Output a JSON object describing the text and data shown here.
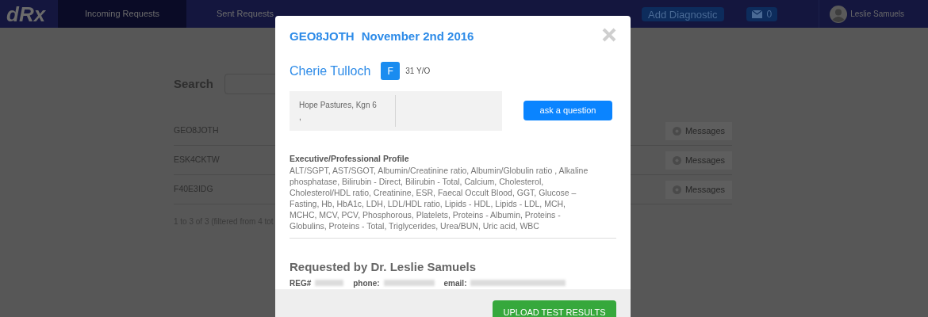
{
  "nav": {
    "logo": "dRx",
    "tabs": [
      {
        "label": "Incoming Requests",
        "selected": true
      },
      {
        "label": "Sent Requests",
        "selected": false
      }
    ],
    "add_button": "Add Diagnostic",
    "messages_count": "0",
    "user": "Leslie Samuels"
  },
  "page": {
    "search_label": "Search",
    "rows": [
      {
        "code": "GEO8JOTH",
        "button": "Messages"
      },
      {
        "code": "ESK4CKTW",
        "button": "Messages"
      },
      {
        "code": "F40E3IDG",
        "button": "Messages"
      }
    ],
    "footer": "1 to 3 of 3 (filtered from 4 tot"
  },
  "modal": {
    "code": "GEO8JOTH",
    "date": "November 2nd 2016",
    "patient": "Cherie Tulloch",
    "sex": "F",
    "age": "31 Y/O",
    "address": [
      "Hope Pastures, Kgn 6",
      ","
    ],
    "ask_button": "ask a question",
    "profile_title": "Executive/Professional Profile",
    "tests": "ALT/SGPT, AST/SGOT, Albumin/Creatinine ratio, Albumin/Globulin ratio , Alkaline phosphatase, Bilirubin - Direct, Bilirubin - Total, Calcium, Cholesterol, Cholesterol/HDL ratio, Creatinine, ESR, Faecal Occult Blood, GGT, Glucose – Fasting, Hb, HbA1c, LDH, LDL/HDL ratio, Lipids - HDL, Lipids - LDL, MCH, MCHC, MCV, PCV, Phosphorous, Platelets, Proteins - Albumin, Proteins - Globulins, Proteins - Total, Triglycerides, Urea/BUN, Uric acid, WBC",
    "requested_by": "Requested by Dr. Leslie Samuels",
    "contact_labels": [
      "REG#",
      "phone:",
      "email:"
    ],
    "upload_button": "UPLOAD TEST RESULTS"
  }
}
